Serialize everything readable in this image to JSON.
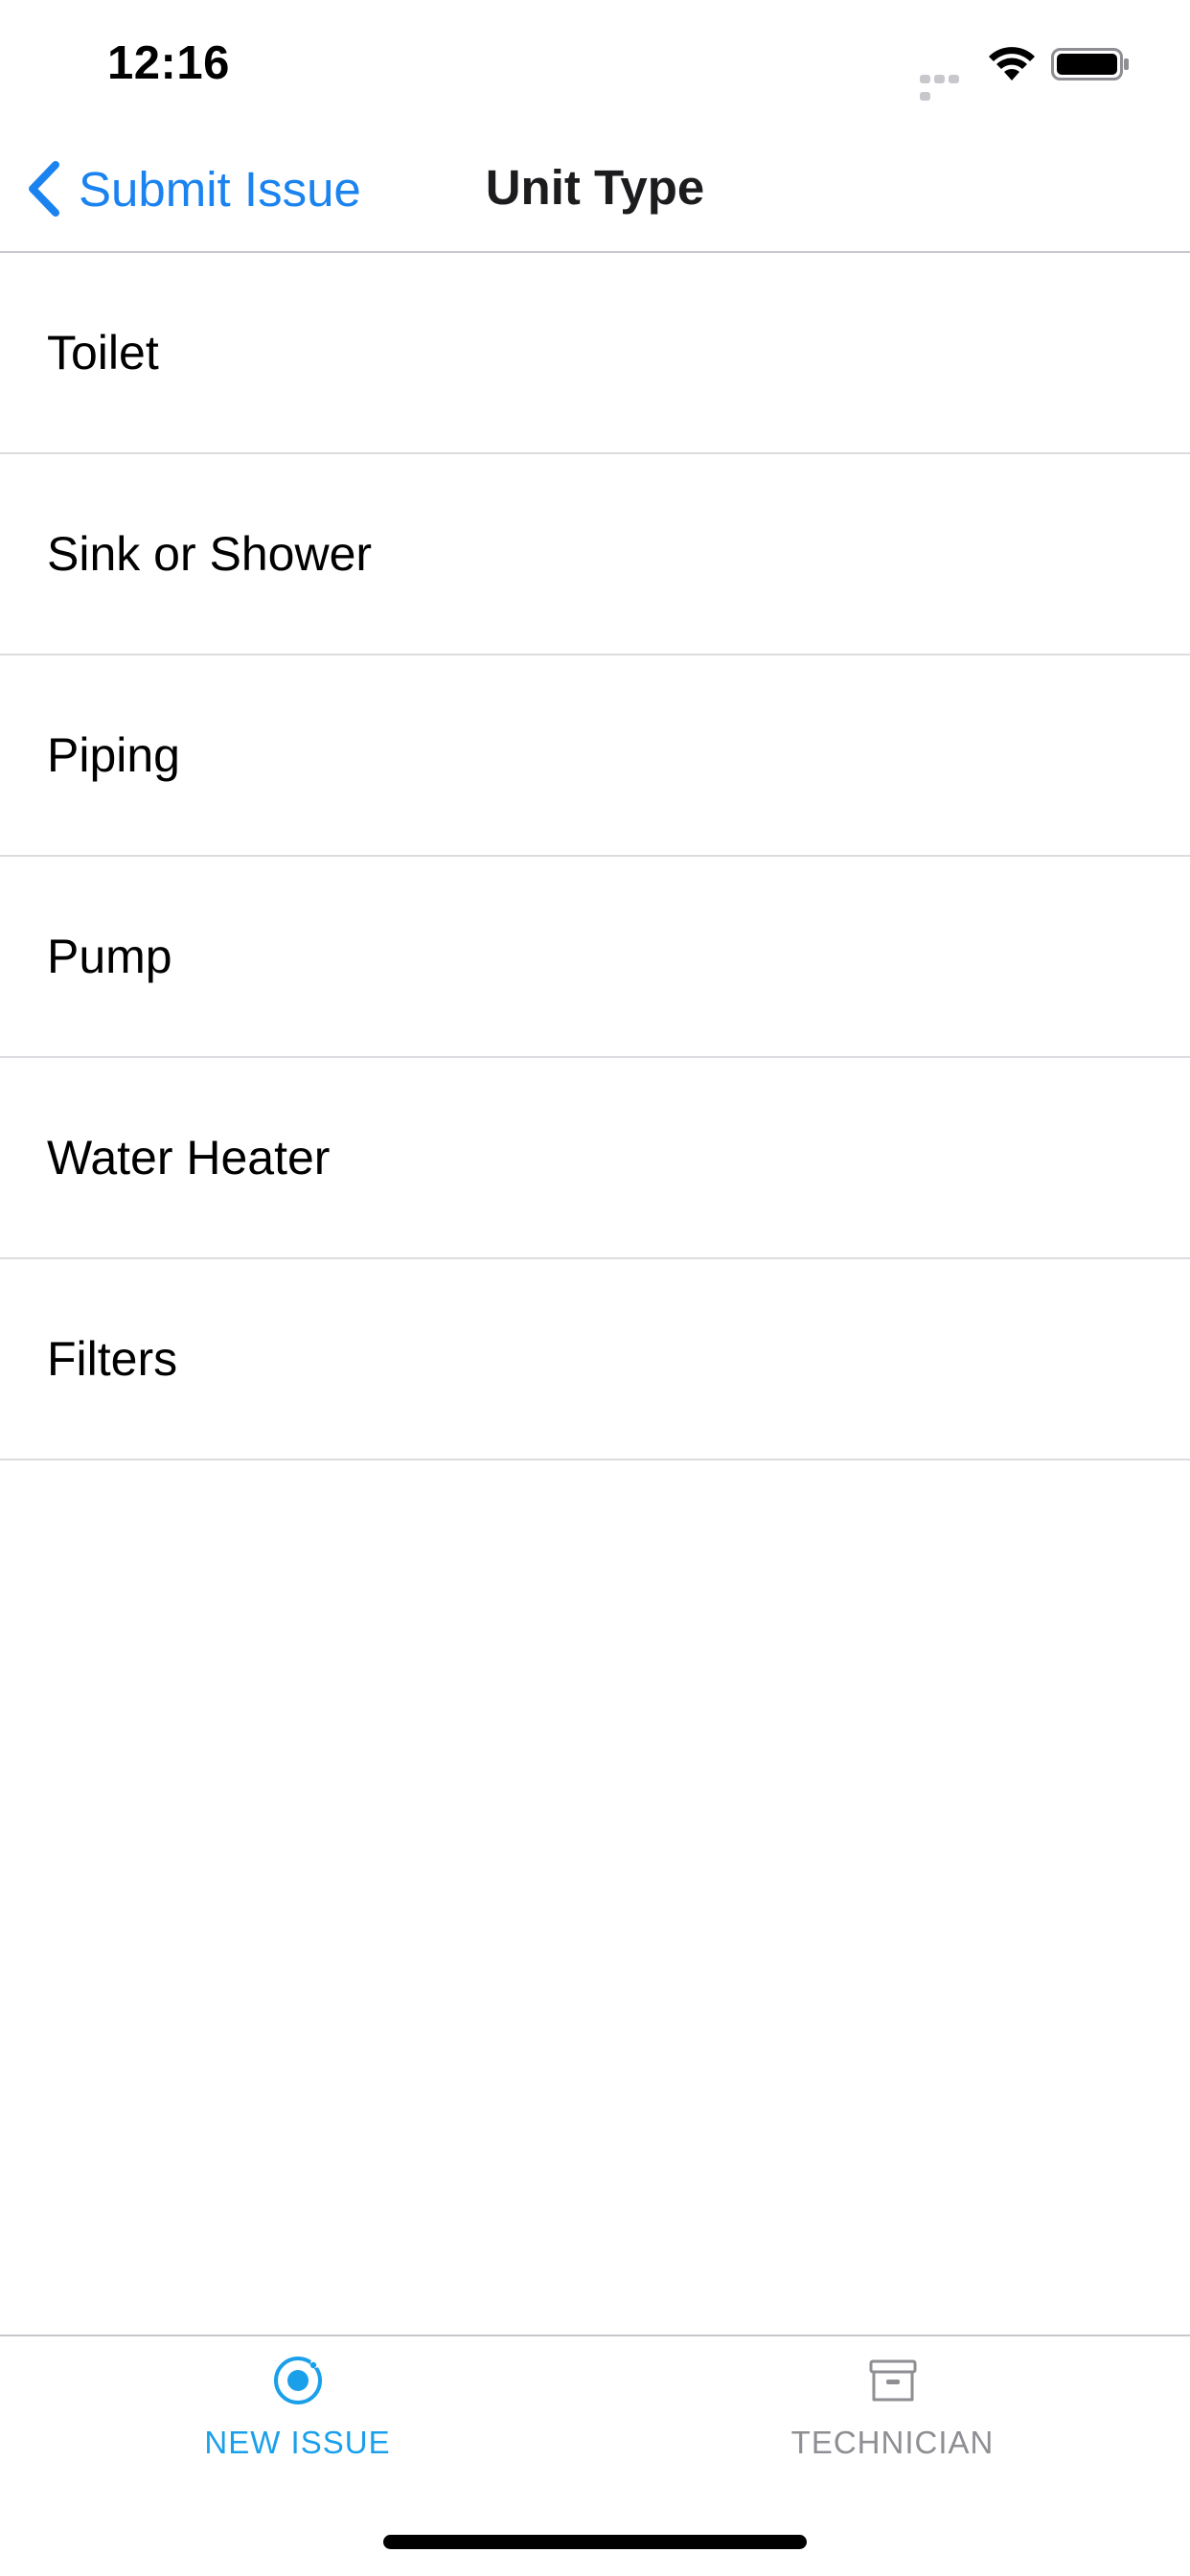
{
  "status_bar": {
    "time": "12:16"
  },
  "nav_bar": {
    "back_label": "Submit Issue",
    "title": "Unit Type"
  },
  "list": {
    "items": [
      {
        "label": "Toilet"
      },
      {
        "label": "Sink or Shower"
      },
      {
        "label": "Piping"
      },
      {
        "label": "Pump"
      },
      {
        "label": "Water Heater"
      },
      {
        "label": "Filters"
      }
    ]
  },
  "tab_bar": {
    "tabs": [
      {
        "label": "NEW ISSUE",
        "icon": "radio-button-on-icon",
        "active": true
      },
      {
        "label": "TECHNICIAN",
        "icon": "archive-icon",
        "active": false
      }
    ]
  },
  "colors": {
    "accent_blue": "#1a83f0",
    "tab_active": "#1aa0ea",
    "tab_inactive": "#8e8e93",
    "separator": "#dcdce0"
  }
}
